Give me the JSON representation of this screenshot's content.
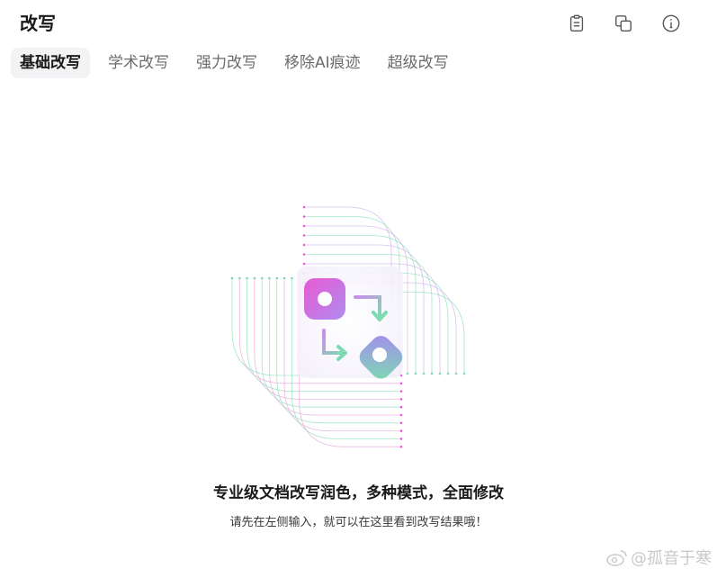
{
  "header": {
    "title": "改写",
    "icons": [
      "clipboard-icon",
      "copy-icon",
      "info-icon"
    ]
  },
  "tabs": [
    {
      "label": "基础改写",
      "active": true
    },
    {
      "label": "学术改写",
      "active": false
    },
    {
      "label": "强力改写",
      "active": false
    },
    {
      "label": "移除AI痕迹",
      "active": false
    },
    {
      "label": "超级改写",
      "active": false
    }
  ],
  "empty_state": {
    "headline": "专业级文档改写润色，多种模式，全面修改",
    "description": "请先在左侧输入，就可以在这里看到改写结果哦！"
  },
  "watermark": "@孤音于寒",
  "colors": {
    "accent_pink": "#e85bd2",
    "accent_green": "#7ddbb0",
    "accent_purple": "#a58bf0",
    "tab_active_bg": "#f3f3f5"
  }
}
